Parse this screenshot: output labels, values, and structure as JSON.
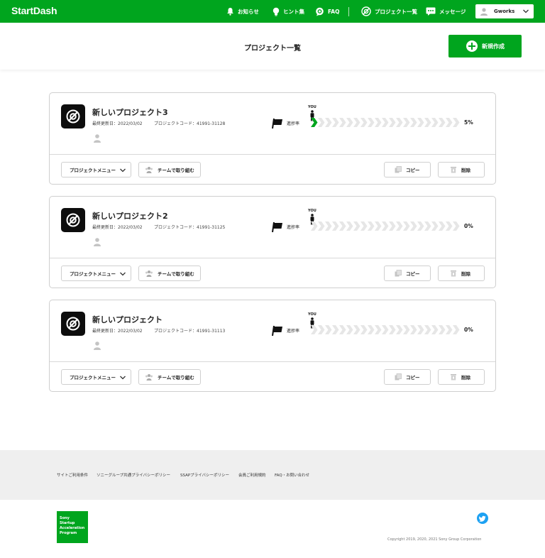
{
  "app": {
    "logo": "StartDash"
  },
  "nav": {
    "items": [
      {
        "label": "お知らせ",
        "icon": "bell-icon"
      },
      {
        "label": "ヒント集",
        "icon": "lightbulb-icon"
      },
      {
        "label": "FAQ",
        "icon": "faq-icon"
      },
      {
        "label": "プロジェクト一覧",
        "icon": "project-icon"
      },
      {
        "label": "メッセージ",
        "icon": "message-icon"
      }
    ],
    "user": {
      "name": "Gworks",
      "icon": "user-avatar-icon"
    }
  },
  "header": {
    "title": "プロジェクト一覧",
    "new_button": "新規作成"
  },
  "projects": [
    {
      "name": "新しいプロジェクト3",
      "updated_label": "最終更新日：",
      "updated": "2022/03/02",
      "code_label": "プロジェクトコード：",
      "code": "41991-31128",
      "progress_label": "進捗率",
      "you_label": "YOU",
      "progress_percent": 5,
      "progress_text": "5%",
      "menu_label": "プロジェクトメニュー",
      "team_label": "チームで取り組む",
      "copy_label": "コピー",
      "delete_label": "削除"
    },
    {
      "name": "新しいプロジェクト2",
      "updated_label": "最終更新日：",
      "updated": "2022/03/02",
      "code_label": "プロジェクトコード：",
      "code": "41991-31125",
      "progress_label": "進捗率",
      "you_label": "YOU",
      "progress_percent": 0,
      "progress_text": "0%",
      "menu_label": "プロジェクトメニュー",
      "team_label": "チームで取り組む",
      "copy_label": "コピー",
      "delete_label": "削除"
    },
    {
      "name": "新しいプロジェクト",
      "updated_label": "最終更新日：",
      "updated": "2022/03/02",
      "code_label": "プロジェクトコード：",
      "code": "41991-31113",
      "progress_label": "進捗率",
      "you_label": "YOU",
      "progress_percent": 0,
      "progress_text": "0%",
      "menu_label": "プロジェクトメニュー",
      "team_label": "チームで取り組む",
      "copy_label": "コピー",
      "delete_label": "削除"
    }
  ],
  "footer": {
    "links": [
      "サイトご利用条件",
      "ソニーグループ共通プライバシーポリシー",
      "SSAPプライバシーポリシー",
      "会員ご利用規約",
      "FAQ・お問い合わせ"
    ],
    "logo_lines": [
      "Sony",
      "Startup",
      "Acceleration",
      "Program"
    ],
    "copyright": "Copyright 2019, 2020, 2021 Sony Group Corporation"
  },
  "colors": {
    "brand_green": "#00a51e",
    "chevron_empty": "#e6e6e6",
    "twitter_blue": "#1da1f2"
  }
}
